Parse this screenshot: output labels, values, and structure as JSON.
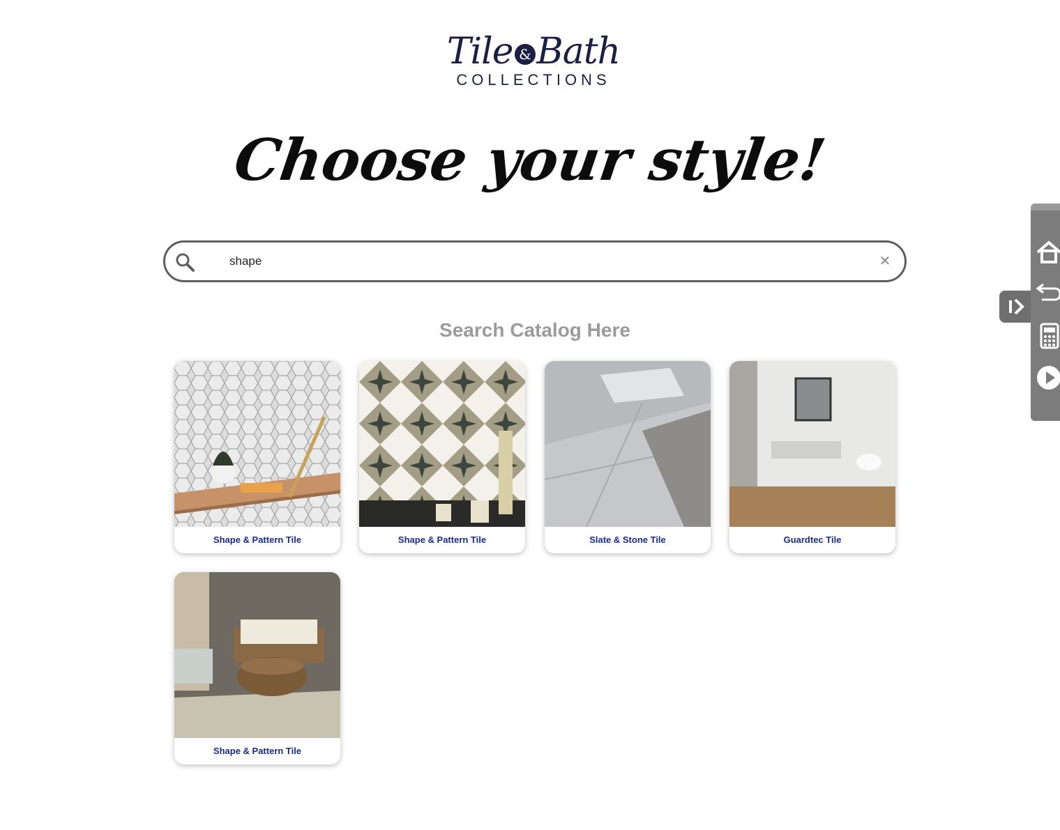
{
  "brand": {
    "logo_script_left": "Tile",
    "logo_amp": "&",
    "logo_script_right": "Bath",
    "logo_sub": "COLLECTIONS"
  },
  "headline": "Choose your style!",
  "search": {
    "value": "shape",
    "caption": "Search Catalog Here"
  },
  "results": [
    {
      "label": "Shape & Pattern Tile",
      "image": "hexagon-marble-wall-shelf"
    },
    {
      "label": "Shape & Pattern Tile",
      "image": "star-pattern-tile-floor"
    },
    {
      "label": "Slate & Stone Tile",
      "image": "grey-floor-living-room"
    },
    {
      "label": "Guardtec Tile",
      "image": "bathroom-vanity-brown-floor"
    },
    {
      "label": "Shape & Pattern Tile",
      "image": "patio-wicker-sofa"
    }
  ],
  "toolbar": {
    "icons": [
      "home-icon",
      "back-icon",
      "calculator-icon",
      "play-icon"
    ],
    "toggle_icon": "collapse-arrow-icon"
  },
  "colors": {
    "brand_navy": "#1b1f45",
    "card_label": "#1a2a8a",
    "caption_grey": "#9b9b9b",
    "toolbar_grey": "#7c7c7c"
  }
}
